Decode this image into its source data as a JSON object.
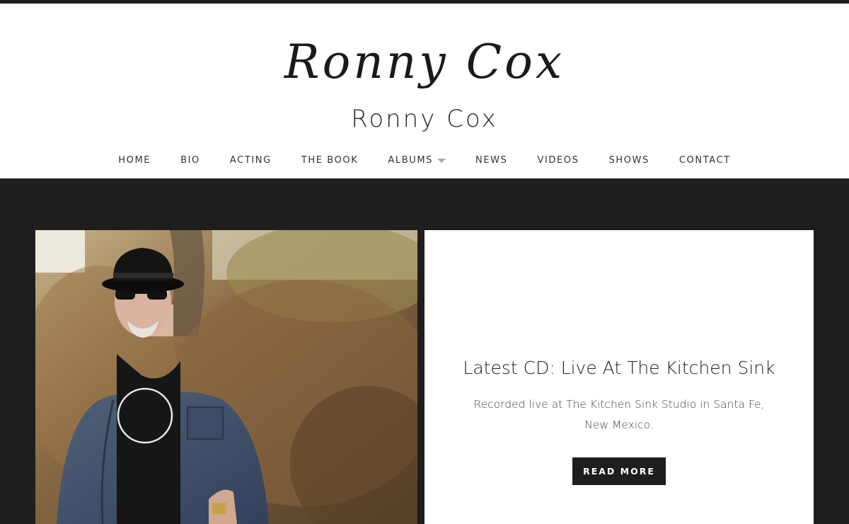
{
  "header": {
    "logo_script": "Ronny Cox",
    "site_title": "Ronny Cox"
  },
  "nav": {
    "items": [
      {
        "label": "HOME"
      },
      {
        "label": "BIO"
      },
      {
        "label": "ACTING"
      },
      {
        "label": "THE BOOK"
      },
      {
        "label": "ALBUMS",
        "has_dropdown": true
      },
      {
        "label": "NEWS"
      },
      {
        "label": "VIDEOS"
      },
      {
        "label": "SHOWS"
      },
      {
        "label": "CONTACT"
      }
    ]
  },
  "feature": {
    "title": "Latest CD: Live At The Kitchen Sink",
    "description": "Recorded live at The Kitchen Sink Studio in Santa Fe, New Mexico.",
    "button_label": "READ MORE"
  },
  "colors": {
    "dark_background": "#1e1e1e",
    "header_background": "#ffffff",
    "card_background": "#ffffff",
    "button_background": "#1e1e1e",
    "button_text": "#ffffff"
  }
}
